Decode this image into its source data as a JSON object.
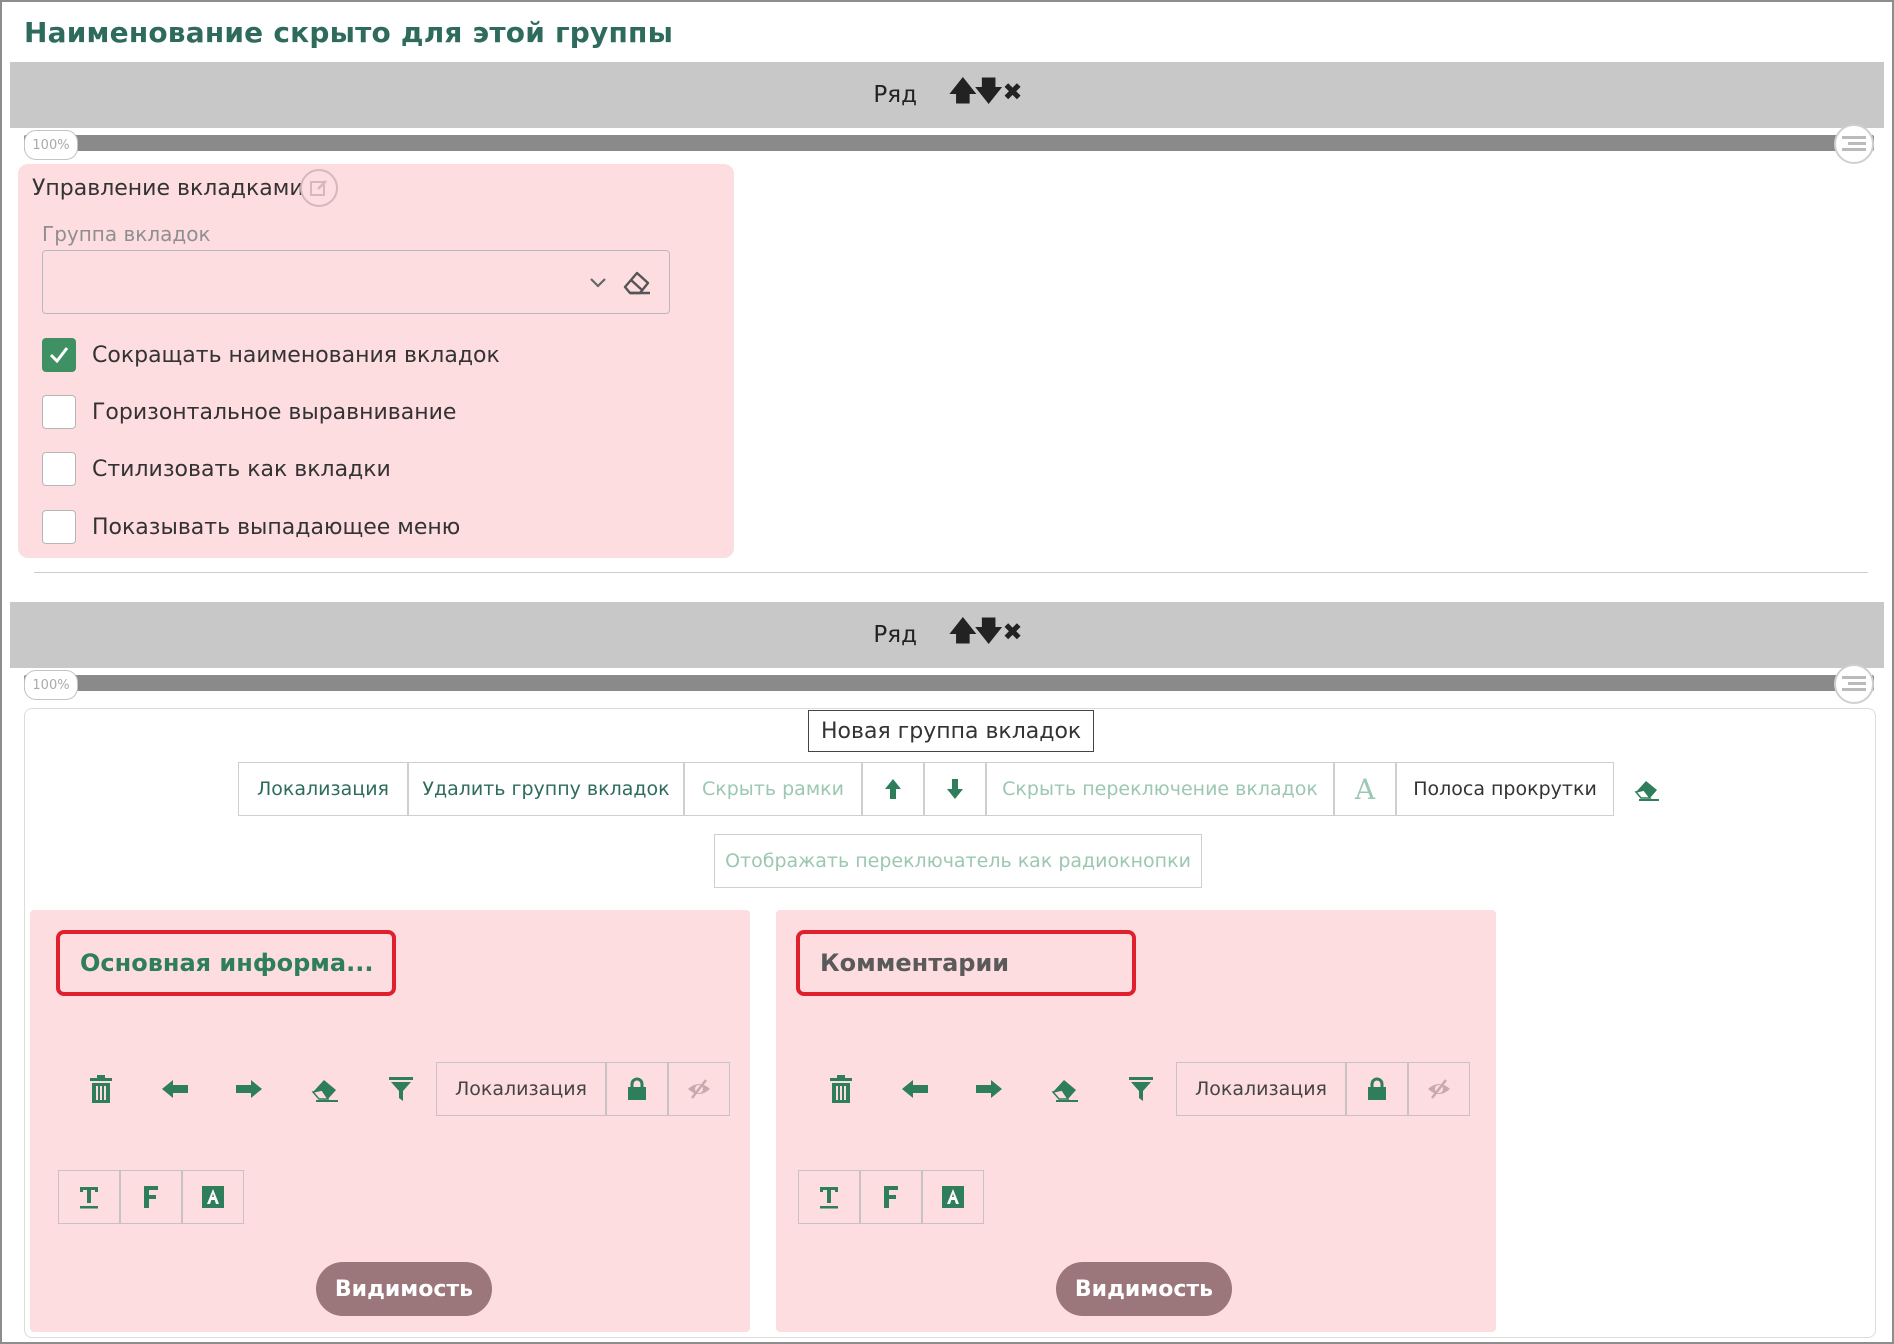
{
  "group": {
    "title": "Наименование скрыто для этой группы"
  },
  "rows": [
    {
      "label": "Ряд",
      "icons": [
        "arrow-up-icon",
        "arrow-down-icon",
        "close-icon"
      ],
      "progress_label": "100%"
    },
    {
      "label": "Ряд",
      "icons": [
        "arrow-up-icon",
        "arrow-down-icon",
        "close-icon"
      ],
      "progress_label": "100%"
    }
  ],
  "tab_management": {
    "title": "Управление вкладками",
    "tab_group_label": "Группа вкладок",
    "tab_group_value": "",
    "options": [
      {
        "label": "Сокращать наименования вкладок",
        "checked": true
      },
      {
        "label": "Горизонтальное выравнивание",
        "checked": false
      },
      {
        "label": "Стилизовать как вкладки",
        "checked": false
      },
      {
        "label": "Показывать выпадающее меню",
        "checked": false
      }
    ]
  },
  "tab_group": {
    "title": "Новая группа вкладок",
    "toolbar": {
      "localization": "Локализация",
      "delete_group": "Удалить группу вкладок",
      "hide_borders": "Скрыть рамки",
      "hide_tab_switch": "Скрыть переключение вкладок",
      "font_glyph": "A",
      "scrollbar": "Полоса прокрутки",
      "radio_switch": "Отображать переключатель как радиокнопки"
    },
    "tabs": [
      {
        "name": "Основная информа...",
        "localization": "Локализация",
        "visibility": "Видимость",
        "name_color": "#2e7d5b"
      },
      {
        "name": "Комментарии",
        "localization": "Локализация",
        "visibility": "Видимость",
        "name_color": "#5a5a5a"
      }
    ]
  },
  "colors": {
    "accent": "#2e6b5c",
    "panel_bg": "#fddde0",
    "highlight_border": "#e0202c",
    "visibility_btn": "#9b767b"
  }
}
